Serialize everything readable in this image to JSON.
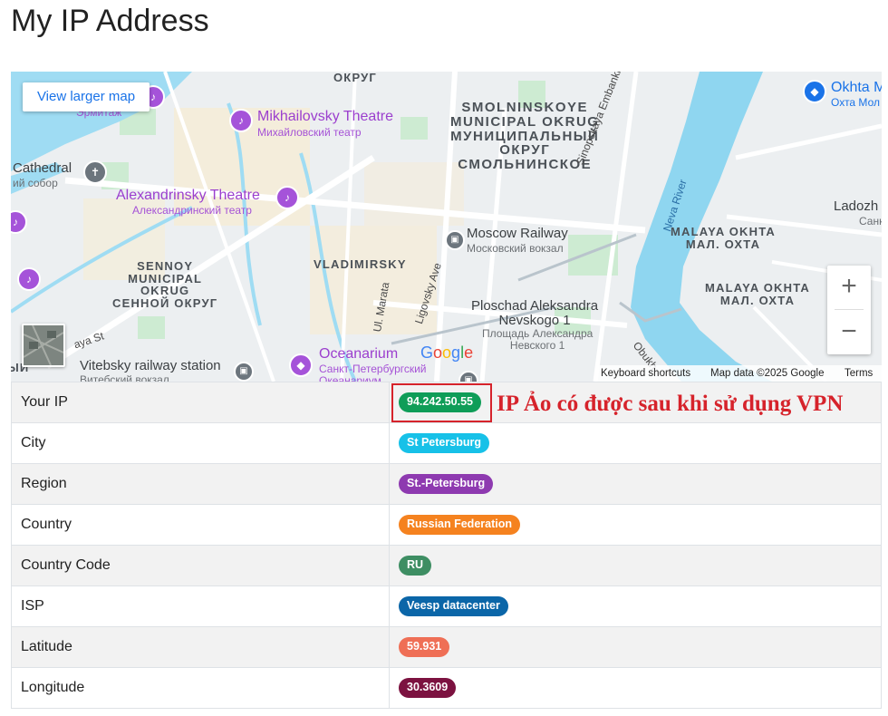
{
  "page": {
    "title": "My IP Address"
  },
  "map": {
    "larger_map_label": "View larger map",
    "zoom_in_label": "+",
    "zoom_out_label": "−",
    "footer": {
      "shortcuts": "Keyboard shortcuts",
      "data": "Map data ©2025 Google",
      "terms": "Terms"
    },
    "logo": [
      "G",
      "o",
      "o",
      "g",
      "l",
      "e"
    ],
    "logo_colors": [
      "#4285f4",
      "#ea4335",
      "#fbbc05",
      "#4285f4",
      "#34a853",
      "#ea4335"
    ],
    "labels": {
      "smolninskoye": "SMOLNINSKOYE\nMUNICIPAL OKRUG\nМУНИЦИПАЛЬНЫЙ\nОКРУГ\nСМОЛЬНИНСКОЕ",
      "mikhailovsky": "Mikhailovsky Theatre",
      "mikhailovsky_ru": "Михайловский театр",
      "alexandrinsky": "Alexandrinsky Theatre",
      "alexandrinsky_ru": "Александринский театр",
      "cathedral": "Cathedral",
      "cathedral_ru": "ий собор",
      "ermitazh": "Эрмитаж",
      "moscow_railway": "Moscow Railway",
      "moscow_railway_ru": "Московский вокзал",
      "sennoy": "SENNOY\nMUNICIPAL\nOKRUG\nСЕННОЙ ОКРУГ",
      "vladimirsky": "VLADIMIRSKY",
      "ploschad": "Ploschad Aleksandra\nNevskogo 1",
      "ploschad_ru": "Площадь Александра\nНевского 1",
      "oceanarium": "Oceanarium",
      "oceanarium_ru": "Санкт-Петербургский\nОкеанариум",
      "vitebsky": "Vitebsky railway station",
      "vitebsky_ru": "Витебский вокзал",
      "malaya_okhta_1": "MALAYA OKHTA\nМАЛ. ОХТА",
      "malaya_okhta_2": "MALAYA OKHTA\nМАЛ. ОХТА",
      "okhta": "Okhta M",
      "okhta_ru": "Охта Мол",
      "ladozh": "Ladozh",
      "ladozh_ru": "Санк",
      "okrug_top": "ОКРУГ",
      "sinopskaya": "Sinopskaya Embankment",
      "neva_river": "Neva River",
      "ul_marata": "Ul. Marata",
      "ligovsky": "Ligovsky Ave",
      "obukh": "Obukh",
      "aya_st": "aya St",
      "mn": "ЫИ"
    }
  },
  "info_table": {
    "rows": [
      {
        "label": "Your IP",
        "value": "94.242.50.55",
        "color": "#0f9d58"
      },
      {
        "label": "City",
        "value": "St Petersburg",
        "color": "#17c1e8"
      },
      {
        "label": "Region",
        "value": "St.-Petersburg",
        "color": "#8e3ab0"
      },
      {
        "label": "Country",
        "value": "Russian Federation",
        "color": "#f5821f"
      },
      {
        "label": "Country Code",
        "value": "RU",
        "color": "#3e8e63"
      },
      {
        "label": "ISP",
        "value": "Veesp datacenter",
        "color": "#0b66a8"
      },
      {
        "label": "Latitude",
        "value": "59.931",
        "color": "#ef6f56"
      },
      {
        "label": "Longitude",
        "value": "30.3609",
        "color": "#7c1240"
      }
    ]
  },
  "annotation": {
    "text": "IP Ảo có được sau khi sử dụng VPN",
    "color": "#d6232b"
  }
}
